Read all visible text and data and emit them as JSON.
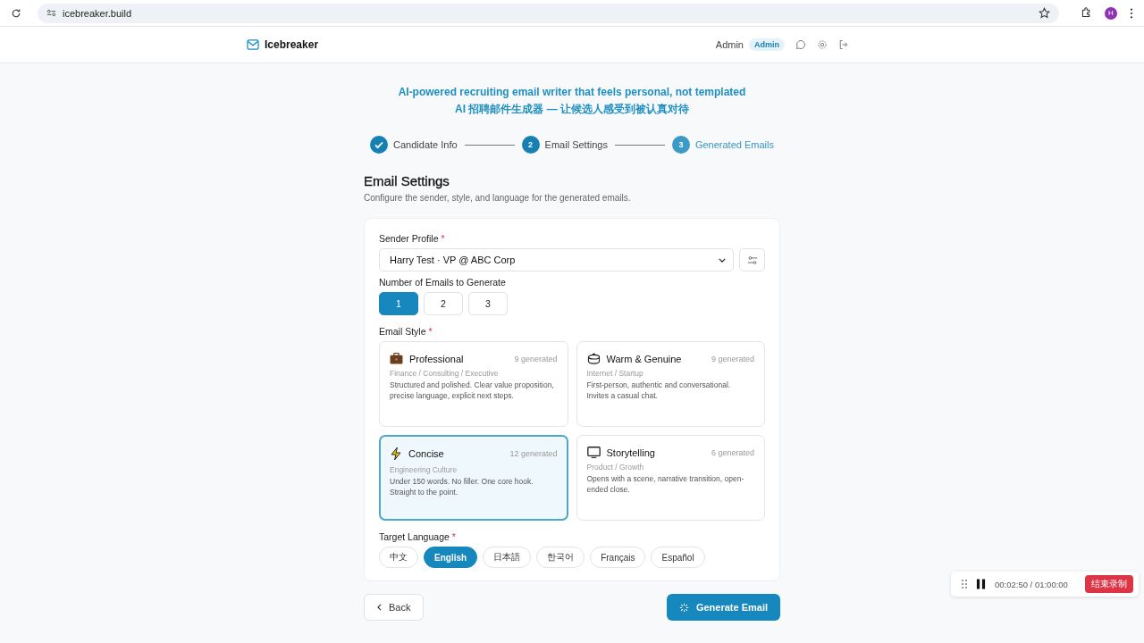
{
  "browser": {
    "url": "icebreaker.build",
    "profile_initial": "H"
  },
  "header": {
    "brand": "Icebreaker",
    "user": "Admin",
    "role_badge": "Admin"
  },
  "tagline": [
    "AI-powered recruiting email writer that feels personal, not templated",
    "AI 招聘邮件生成器 — 让候选人感受到被认真对待"
  ],
  "steps": [
    {
      "kind": "done",
      "label": "Candidate Info"
    },
    {
      "kind": "current",
      "number": "2",
      "label": "Email Settings"
    },
    {
      "kind": "upcoming",
      "number": "3",
      "label": "Generated Emails"
    }
  ],
  "section": {
    "title": "Email Settings",
    "description": "Configure the sender, style, and language for the generated emails."
  },
  "sender": {
    "label": "Sender Profile",
    "required_mark": "*",
    "value": "Harry Test · VP @ ABC Corp"
  },
  "count": {
    "label": "Number of Emails to Generate",
    "options": [
      {
        "label": "1",
        "selected": true
      },
      {
        "label": "2",
        "selected": false
      },
      {
        "label": "3",
        "selected": false
      }
    ]
  },
  "style": {
    "label": "Email Style",
    "required_mark": "*",
    "options": [
      {
        "kind": "briefcase",
        "name": "Professional",
        "count": "9 generated",
        "audience": "Finance / Consulting / Executive",
        "description": "Structured and polished. Clear value proposition, precise language, explicit next steps.",
        "selected": false
      },
      {
        "kind": "pot",
        "name": "Warm & Genuine",
        "count": "9 generated",
        "audience": "Internet / Startup",
        "description": "First-person, authentic and conversational. Invites a casual chat.",
        "selected": false
      },
      {
        "kind": "bolt",
        "name": "Concise",
        "count": "12 generated",
        "audience": "Engineering Culture",
        "description": "Under 150 words. No filler. One core hook. Straight to the point.",
        "selected": true
      },
      {
        "kind": "screen",
        "name": "Storytelling",
        "count": "6 generated",
        "audience": "Product / Growth",
        "description": "Opens with a scene, narrative transition, open-ended close.",
        "selected": false
      }
    ]
  },
  "language": {
    "label": "Target Language",
    "required_mark": "*",
    "options": [
      {
        "label": "中文",
        "selected": false
      },
      {
        "label": "English",
        "selected": true
      },
      {
        "label": "日本語",
        "selected": false
      },
      {
        "label": "한국어",
        "selected": false
      },
      {
        "label": "Français",
        "selected": false
      },
      {
        "label": "Español",
        "selected": false
      }
    ]
  },
  "actions": {
    "back": "Back",
    "generate": "Generate Email"
  },
  "recorder": {
    "time": "00:02:50 / 01:00:00",
    "stop": "结束录制"
  }
}
